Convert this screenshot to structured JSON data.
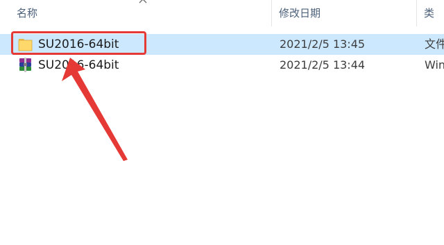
{
  "columns": {
    "name": "名称",
    "date_modified": "修改日期",
    "type": "类型"
  },
  "files": [
    {
      "name": "SU2016-64bit",
      "date": "2021/2/5 13:45",
      "type": "文件夹",
      "icon": "folder-icon",
      "selected": true
    },
    {
      "name": "SU2016-64bit",
      "date": "2021/2/5 13:44",
      "type": "WinRAR",
      "icon": "winrar-archive-icon",
      "selected": false
    }
  ],
  "annotation": {
    "box_color": "#e53935",
    "arrow_color": "#e53935"
  },
  "colors": {
    "selection": "#cce8ff",
    "header_text": "#4c607a"
  }
}
